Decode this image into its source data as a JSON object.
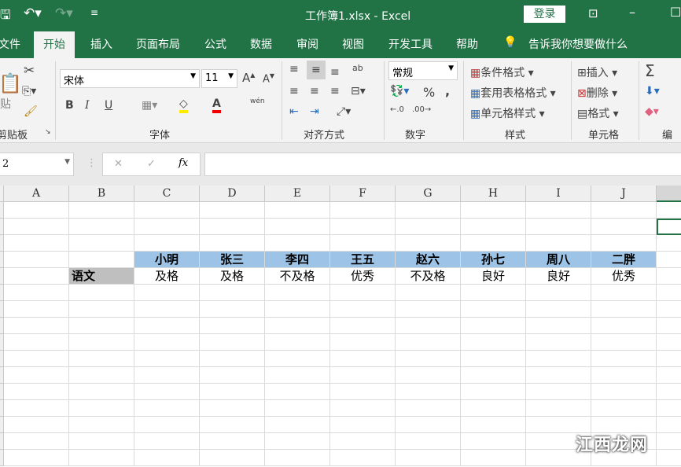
{
  "title": "工作簿1.xlsx  -  Excel",
  "login": "登录",
  "tabs": [
    "文件",
    "开始",
    "插入",
    "页面布局",
    "公式",
    "数据",
    "审阅",
    "视图",
    "开发工具",
    "帮助"
  ],
  "tell_me": "告诉我你想要做什么",
  "ribbon": {
    "clipboard": {
      "paste": "贴",
      "group": "剪贴板"
    },
    "font": {
      "name": "宋体",
      "size": "11",
      "bold": "B",
      "italic": "I",
      "underline": "U",
      "group": "字体",
      "phonetic": "wén"
    },
    "alignment": {
      "group": "对齐方式"
    },
    "number": {
      "format": "常规",
      "percent": "%",
      "comma": ",",
      "group": "数字"
    },
    "styles": {
      "conditional": "条件格式",
      "table": "套用表格格式",
      "cell": "单元格样式",
      "group": "样式"
    },
    "cells": {
      "insert": "插入",
      "delete": "删除",
      "format": "格式",
      "group": "单元格"
    },
    "editing": {
      "sum": "Σ",
      "group": "编辑"
    }
  },
  "formula_bar": {
    "name_box": "2",
    "cancel": "✕",
    "enter": "✓",
    "fx": "fx",
    "value": ""
  },
  "columns": [
    "A",
    "B",
    "C",
    "D",
    "E",
    "F",
    "G",
    "H",
    "I",
    "J"
  ],
  "sheet": {
    "names": [
      "小明",
      "张三",
      "李四",
      "王五",
      "赵六",
      "孙七",
      "周八",
      "二胖"
    ],
    "subject": "语文",
    "grades": [
      "及格",
      "及格",
      "不及格",
      "优秀",
      "不及格",
      "良好",
      "良好",
      "优秀"
    ]
  },
  "colors": {
    "green": "#217346",
    "header_fill": "#9dc3e6",
    "subject_fill": "#bfbfbf"
  },
  "watermark": "江西龙网"
}
